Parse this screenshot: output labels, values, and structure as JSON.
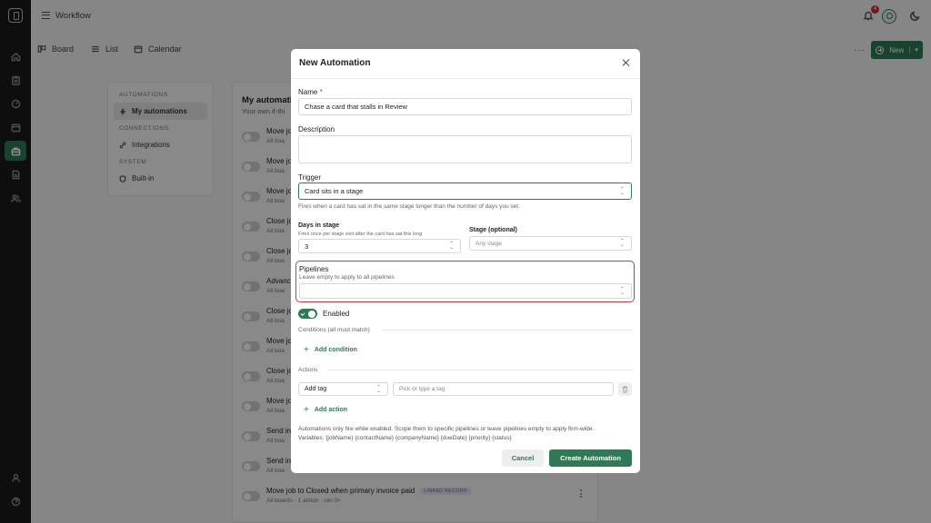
{
  "app": {
    "title": "Workflow",
    "notification_count": "4"
  },
  "views": {
    "board": "Board",
    "list": "List",
    "calendar": "Calendar",
    "more": "···",
    "new_label": "New"
  },
  "side_menu": {
    "automations_label": "AUTOMATIONS",
    "my_automations": "My automations",
    "connections_label": "CONNECTIONS",
    "integrations": "Integrations",
    "system_label": "SYSTEM",
    "built_in": "Built-in"
  },
  "list": {
    "title": "My automatio",
    "subtitle": "Your own if-thi",
    "rows": [
      {
        "title": "Move jo",
        "meta": "All boa"
      },
      {
        "title": "Move jo",
        "meta": "All boa"
      },
      {
        "title": "Move jo",
        "meta": "All boa"
      },
      {
        "title": "Close jo",
        "meta": "All boa"
      },
      {
        "title": "Close jo",
        "meta": "All boa"
      },
      {
        "title": "Advanc",
        "meta": "All boa"
      },
      {
        "title": "Close jo",
        "meta": "All boa"
      },
      {
        "title": "Move jo",
        "meta": "All boa"
      },
      {
        "title": "Close jo",
        "meta": "All boa"
      },
      {
        "title": "Move jo",
        "meta": "All boa"
      },
      {
        "title": "Send in",
        "meta": "All boa"
      },
      {
        "title": "Send in",
        "meta": "All boa"
      },
      {
        "title": "Move job to Closed when primary invoice paid",
        "meta": "All boards · 1 action · ran 0×",
        "badge": "LINKED RECORD"
      }
    ]
  },
  "modal": {
    "title": "New Automation",
    "name_label": "Name",
    "name_required": "*",
    "name_value": "Chase a card that stalls in Review",
    "description_label": "Description",
    "description_value": "",
    "trigger_label": "Trigger",
    "trigger_value": "Card sits in a stage",
    "trigger_help": "Fires when a card has sat in the same stage longer than the number of days you set.",
    "days_label": "Days in stage",
    "days_help": "Fires once per stage visit after the card has sat this long",
    "days_value": "3",
    "stage_label": "Stage (optional)",
    "stage_value": "Any stage",
    "pipelines_label": "Pipelines",
    "pipelines_help": "Leave empty to apply to all pipelines",
    "pipelines_value": "",
    "enabled_label": "Enabled",
    "enabled": true,
    "conditions_label": "Conditions (all must match)",
    "add_condition": "Add condition",
    "actions_label": "Actions",
    "action_type": "Add tag",
    "tag_placeholder": "Pick or type a tag",
    "add_action": "Add action",
    "note_line1": "Automations only fire while enabled. Scope them to specific pipelines or leave pipelines empty to apply firm-wide.",
    "note_line2": "Variables: {jobName} {contactName} {companyName} {dueDate} {priority} {status}",
    "cancel": "Cancel",
    "create": "Create Automation"
  },
  "colors": {
    "accent": "#2e7a55",
    "highlight": "#d2393a",
    "badge": "#c9302c",
    "rail": "#1b1b1b"
  },
  "icons": [
    "home-icon",
    "clipboard-icon",
    "gauge-icon",
    "calendar-icon",
    "briefcase-icon",
    "document-icon",
    "users-icon",
    "user-icon",
    "help-icon",
    "bell-icon",
    "moon-icon",
    "bolt-icon",
    "link-icon",
    "shield-icon",
    "trash-icon",
    "close-icon"
  ]
}
